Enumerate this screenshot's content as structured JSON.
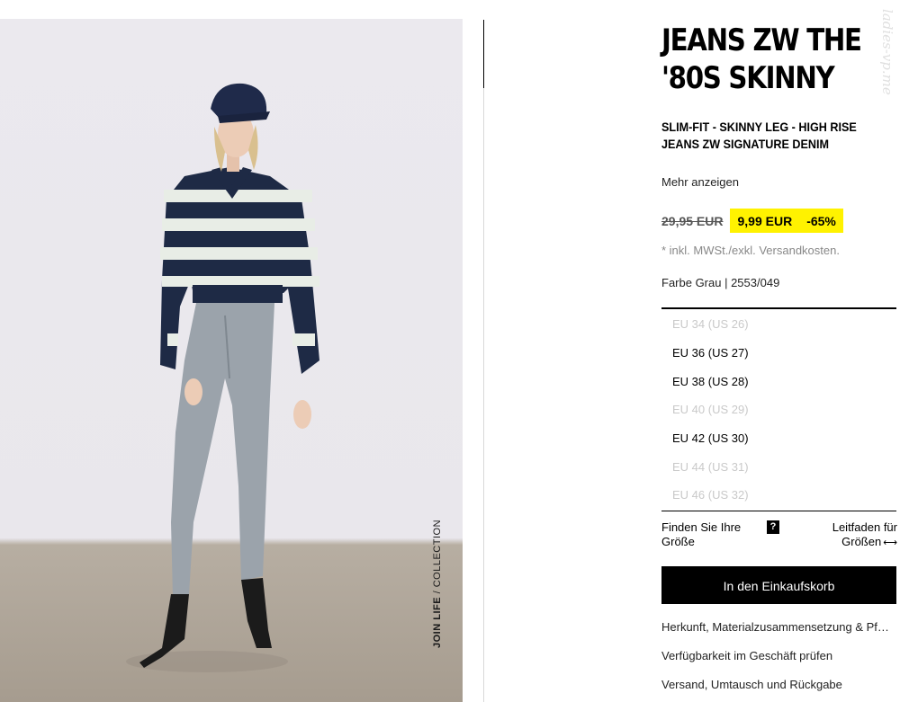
{
  "product": {
    "title_line1": "JEANS ZW THE",
    "title_line2": "'80S SKINNY",
    "subtitle_line1": "SLIM-FIT - SKINNY LEG - HIGH RISE",
    "subtitle_line2": "JEANS ZW SIGNATURE DENIM",
    "more_link": "Mehr anzeigen",
    "old_price": "29,95 EUR",
    "new_price": "9,99 EUR",
    "discount": "-65%",
    "tax_note": "* inkl. MWSt./exkl. Versandkosten.",
    "color_info": "Farbe Grau | 2553/049"
  },
  "sizes": [
    {
      "label": "EU 34 (US 26)",
      "available": false
    },
    {
      "label": "EU 36 (US 27)",
      "available": true
    },
    {
      "label": "EU 38 (US 28)",
      "available": true
    },
    {
      "label": "EU 40 (US 29)",
      "available": false
    },
    {
      "label": "EU 42 (US 30)",
      "available": true
    },
    {
      "label": "EU 44 (US 31)",
      "available": false
    },
    {
      "label": "EU 46 (US 32)",
      "available": false
    }
  ],
  "size_help": {
    "find_line1": "Finden Sie Ihre",
    "find_line2": "Größe",
    "qmark": "?",
    "guide_line1": "Leitfaden für",
    "guide_line2": "Größen",
    "guide_icon": "⟷"
  },
  "actions": {
    "add_to_cart": "In den Einkaufskorb",
    "links": [
      "Herkunft, Materialzusammensetzung & Pf…",
      "Verfügbarkeit im Geschäft prüfen",
      "Versand, Umtausch und Rückgabe"
    ]
  },
  "image": {
    "tag_bold": "JOIN LIFE",
    "tag_rest": " / COLLECTION"
  },
  "watermark": "ladies-vp.me",
  "colors": {
    "promo_highlight": "#fff200",
    "button_bg": "#000000",
    "unavailable_text": "#c9c9c9"
  }
}
